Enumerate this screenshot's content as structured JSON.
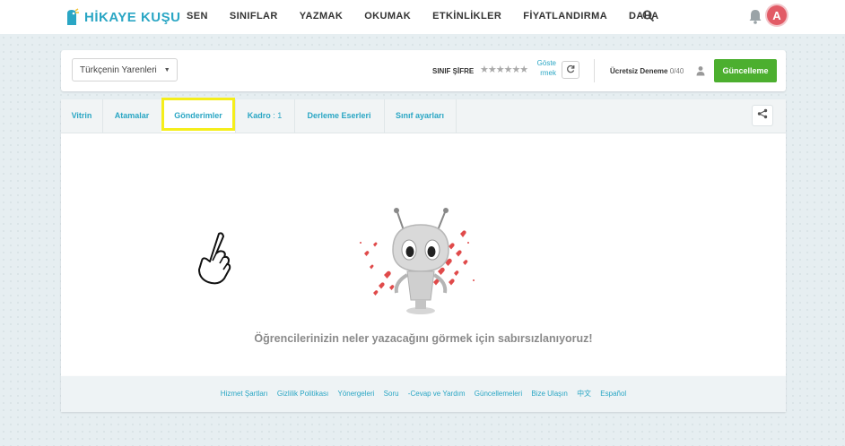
{
  "brand": {
    "name": "HİKAYE KUŞU"
  },
  "nav": {
    "items": [
      "SEN",
      "SINIFLAR",
      "YAZMAK",
      "OKUMAK",
      "ETKİNLİKLER",
      "FİYATLANDIRMA",
      "DAHA"
    ]
  },
  "user": {
    "avatar_letter": "A"
  },
  "classbar": {
    "class_name": "Türkçenin Yarenleri",
    "password_label": "SINIF ŞİFRE",
    "password_mask": "★★★★★★",
    "show_line1": "Göste",
    "show_line2": "rmek",
    "trial_label": "Ücretsiz Deneme",
    "trial_count": "0/40",
    "upgrade_label": "Güncelleme"
  },
  "tabs": [
    {
      "label": "Vitrin"
    },
    {
      "label": "Atamalar"
    },
    {
      "label": "Gönderimler"
    },
    {
      "label": "Kadro",
      "suffix": " : 1"
    },
    {
      "label": "Derleme Eserleri"
    },
    {
      "label": "Sınıf ayarları"
    }
  ],
  "active_tab": "Gönderimler",
  "main": {
    "empty_message": "Öğrencilerinizin neler yazacağını görmek için sabırsızlanıyoruz!"
  },
  "footer": {
    "links": [
      "Hizmet Şartları",
      "Gizlilik Politikası",
      "Yönergeleri",
      "Soru",
      "-Cevap ve Yardım",
      "Güncellemeleri",
      "Bize Ulaşın",
      "中文",
      "Español"
    ]
  },
  "colors": {
    "brand": "#2aa6c4",
    "upgrade": "#4caf2f",
    "highlight": "#f5ee1b",
    "avatar": "#e25b66"
  },
  "icons": [
    "logo-bird-icon",
    "search-icon",
    "bell-icon",
    "refresh-icon",
    "user-icon",
    "share-icon",
    "pointing-hand-icon",
    "robot-illustration"
  ]
}
